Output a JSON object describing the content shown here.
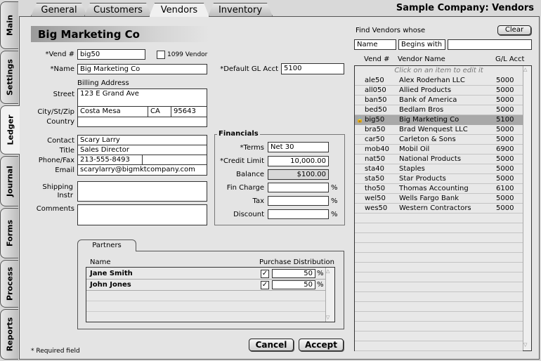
{
  "top_tabs": [
    "General",
    "Customers",
    "Vendors",
    "Inventory"
  ],
  "company_title": "Sample Company:  Vendors",
  "side_tabs": [
    "Main",
    "Settings",
    "Ledger",
    "Journal",
    "Forms",
    "Process",
    "Reports"
  ],
  "vendor_name_header": "Big Marketing Co",
  "form": {
    "vend_label": "*Vend #",
    "vend_value": "big50",
    "vendor1099_label": "1099 Vendor",
    "name_label": "*Name",
    "name_value": "Big Marketing Co",
    "gl_label": "*Default GL Acct",
    "gl_value": "5100",
    "billing_label": "Billing Address",
    "street_label": "Street",
    "street_value": "123 E Grand Ave",
    "csz_label": "City/St/Zip",
    "city": "Costa Mesa",
    "state": "CA",
    "zip": "95643",
    "country_label": "Country",
    "contact_label": "Contact",
    "contact_value": "Scary Larry",
    "title_label": "Title",
    "title_value": "Sales Director",
    "phonefax_label": "Phone/Fax",
    "phone_value": "213-555-8493",
    "email_label": "Email",
    "email_value": "scarylarry@bigmktcompany.com",
    "shipping_label": "Shipping",
    "instr_label": "Instr",
    "comments_label": "Comments",
    "required_note": "* Required field"
  },
  "financials": {
    "title": "Financials",
    "terms_label": "*Terms",
    "terms_value": "Net 30",
    "credit_label": "*Credit Limit",
    "credit_value": "10,000.00",
    "balance_label": "Balance",
    "balance_value": "$100.00",
    "fincharge_label": "Fin Charge",
    "tax_label": "Tax",
    "discount_label": "Discount",
    "pct": "%"
  },
  "partners": {
    "tab_label": "Partners",
    "col_name": "Name",
    "col_dist": "Purchase Distribution",
    "rows": [
      {
        "name": "Jane Smith",
        "value": "50"
      },
      {
        "name": "John Jones",
        "value": "50"
      }
    ]
  },
  "buttons": {
    "cancel": "Cancel",
    "accept": "Accept",
    "clear": "Clear"
  },
  "find": {
    "title": "Find Vendors whose",
    "field": "Name",
    "operator": "Begins with",
    "value": ""
  },
  "vendor_list": {
    "col_vend": "Vend #",
    "col_name": "Vendor Name",
    "col_gl": "G/L Acct",
    "hint": "Click on an item to edit it",
    "rows": [
      {
        "vend": "ale50",
        "name": "Alex Roderhan LLC",
        "gl": "5000"
      },
      {
        "vend": "all050",
        "name": "Allied Products",
        "gl": "5000"
      },
      {
        "vend": "ban50",
        "name": "Bank of America",
        "gl": "5000"
      },
      {
        "vend": "bed50",
        "name": "Bedlam Bros",
        "gl": "5000"
      },
      {
        "vend": "big50",
        "name": "Big Marketing Co",
        "gl": "5100"
      },
      {
        "vend": "bra50",
        "name": "Brad Wenquest LLC",
        "gl": "5000"
      },
      {
        "vend": "car50",
        "name": "Carleton & Sons",
        "gl": "5000"
      },
      {
        "vend": "mob40",
        "name": "Mobil Oil",
        "gl": "6900"
      },
      {
        "vend": "nat50",
        "name": "National Products",
        "gl": "5000"
      },
      {
        "vend": "sta40",
        "name": "Staples",
        "gl": "5000"
      },
      {
        "vend": "sta50",
        "name": "Star Products",
        "gl": "5000"
      },
      {
        "vend": "tho50",
        "name": "Thomas Accounting",
        "gl": "6100"
      },
      {
        "vend": "wel50",
        "name": "Wells Fargo Bank",
        "gl": "5000"
      },
      {
        "vend": "wes50",
        "name": "Western Contractors",
        "gl": "5000"
      }
    ]
  }
}
